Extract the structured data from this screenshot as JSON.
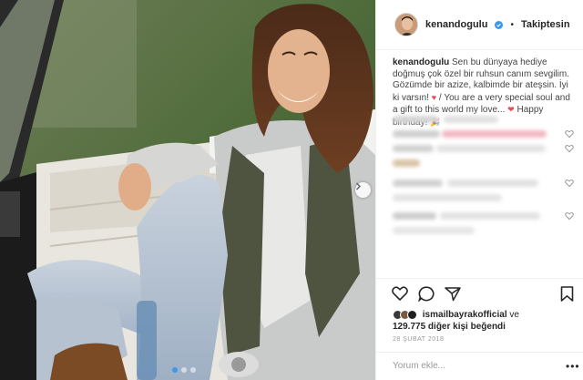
{
  "header": {
    "username": "kenandogulu",
    "separator": "•",
    "follow_label": "Takiptesin"
  },
  "caption": {
    "username": "kenandogulu",
    "text_tr": "Sen bu dünyaya hediye doğmuş çok özel bir ruhsun canım sevgilim. Gözümde bir azize, kalbimde bir ateşsin. İyi ki varsın!",
    "text_sep": "/",
    "text_en": "You are a very special soul and a gift to this world my love...",
    "text_end": "Happy birthday!"
  },
  "likes": {
    "first_liker": "ismailbayrakofficial",
    "connector": "ve",
    "count_text": "129.775 diğer kişi beğendi"
  },
  "date": "28 ŞUBAT 2018",
  "comment_input": {
    "placeholder": "Yorum ekle..."
  },
  "more_label": "•••",
  "colors": {
    "accent_blue": "#3897f0",
    "verified_blue": "#3897f0",
    "heart_red": "#ed4956",
    "border": "#efefef"
  },
  "icons": [
    "verified-badge-icon",
    "like-heart-icon",
    "comment-icon",
    "share-icon",
    "bookmark-icon",
    "chevron-right-icon",
    "small-heart-icon"
  ]
}
